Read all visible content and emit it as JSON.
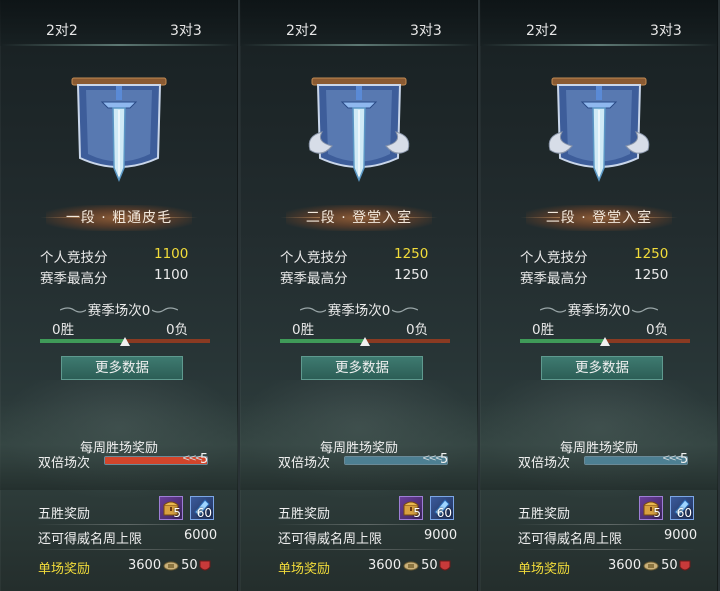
{
  "tabs": {
    "left": "2对2",
    "right": "3对3"
  },
  "panels": [
    {
      "rank": "一段 · 粗通皮毛",
      "personal_label": "个人竞技分",
      "personal_value": "1100",
      "personal_highlight": true,
      "season_high_label": "赛季最高分",
      "season_high_value": "1100",
      "season_games": "赛季场次0",
      "wins": "0胜",
      "losses": "0负",
      "more_button": "更多数据",
      "weekly_title": "每周胜场奖励",
      "double_label": "双倍场次",
      "double_count": "5",
      "double_fill_color": "#d2452b",
      "five_win_label": "五胜奖励",
      "chest_count": "5",
      "gem_count": "60",
      "weekly_cap_label": "还可得威名周上限",
      "weekly_cap_value": "6000",
      "single_label": "单场奖励",
      "single_coin": "3600",
      "single_honor": "50",
      "wing": false
    },
    {
      "rank": "二段 · 登堂入室",
      "personal_label": "个人竞技分",
      "personal_value": "1250",
      "personal_highlight": true,
      "season_high_label": "赛季最高分",
      "season_high_value": "1250",
      "season_games": "赛季场次0",
      "wins": "0胜",
      "losses": "0负",
      "more_button": "更多数据",
      "weekly_title": "每周胜场奖励",
      "double_label": "双倍场次",
      "double_count": "5",
      "double_fill_color": "#4d7f92",
      "five_win_label": "五胜奖励",
      "chest_count": "5",
      "gem_count": "60",
      "weekly_cap_label": "还可得威名周上限",
      "weekly_cap_value": "9000",
      "single_label": "单场奖励",
      "single_coin": "3600",
      "single_honor": "50",
      "wing": true
    },
    {
      "rank": "二段 · 登堂入室",
      "personal_label": "个人竞技分",
      "personal_value": "1250",
      "personal_highlight": true,
      "season_high_label": "赛季最高分",
      "season_high_value": "1250",
      "season_games": "赛季场次0",
      "wins": "0胜",
      "losses": "0负",
      "more_button": "更多数据",
      "weekly_title": "每周胜场奖励",
      "double_label": "双倍场次",
      "double_count": "5",
      "double_fill_color": "#4d7f92",
      "five_win_label": "五胜奖励",
      "chest_count": "5",
      "gem_count": "60",
      "weekly_cap_label": "还可得威名周上限",
      "weekly_cap_value": "9000",
      "single_label": "单场奖励",
      "single_coin": "3600",
      "single_honor": "50",
      "wing": true
    }
  ],
  "colors": {
    "accent_yellow": "#f2dc3a",
    "win_green": "#3f9a58",
    "loss_red": "#8a3a22",
    "button_teal": "#2c5e56"
  },
  "icons": [
    "banner-sword-emblem",
    "treasure-chest-icon",
    "blue-gem-icon",
    "coin-icon",
    "red-shield-icon"
  ]
}
